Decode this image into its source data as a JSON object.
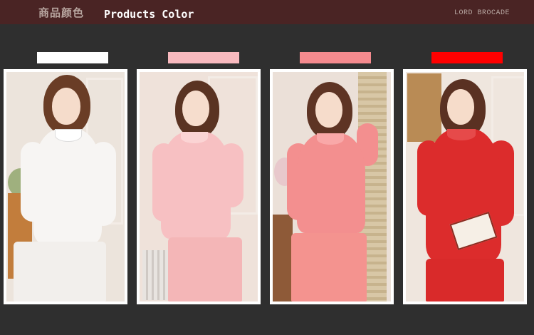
{
  "header": {
    "title_cn": "商品颜色",
    "title_en": "Products Color",
    "brand": "LORD BROCADE"
  },
  "colors": [
    {
      "name": "white",
      "swatch": "#ffffff",
      "top": "#f7f5f3",
      "pants": "#f2efec",
      "wall": "#ece4dc"
    },
    {
      "name": "light-pink",
      "swatch": "#f8b9be",
      "top": "#f7c0c2",
      "pants": "#f4b6b7",
      "wall": "#efe2da"
    },
    {
      "name": "coral-pink",
      "swatch": "#f58a8e",
      "top": "#f38f8f",
      "pants": "#f4938f",
      "wall": "#ebe0d8"
    },
    {
      "name": "red",
      "swatch": "#ff0000",
      "top": "#dc2c2c",
      "pants": "#d92a2a",
      "wall": "#efe6de"
    }
  ]
}
